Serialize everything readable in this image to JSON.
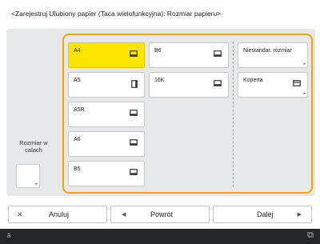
{
  "title": "<Zarejestruj Ulubiony papier (Taca wielofunkcyjna): Rozmiar papieru>",
  "left": {
    "label": "Rozmiar w calach"
  },
  "paper_keys": [
    {
      "label": "A4",
      "icon": "paper-landscape-icon",
      "selected": true
    },
    {
      "label": "A5",
      "icon": "paper-portrait-icon",
      "selected": false
    },
    {
      "label": "A5R",
      "icon": "paper-landscape-icon",
      "selected": false
    },
    {
      "label": "A6",
      "icon": "paper-landscape-icon",
      "selected": false
    },
    {
      "label": "B5",
      "icon": "paper-landscape-icon",
      "selected": false
    },
    {
      "label": "B6",
      "icon": "paper-landscape-icon",
      "selected": false
    },
    {
      "label": "16K",
      "icon": "paper-landscape-icon",
      "selected": false
    }
  ],
  "special_keys": [
    {
      "label": "Niestandar. rozmiar"
    },
    {
      "label": "Koperta",
      "icon": "envelope-icon"
    }
  ],
  "footer": {
    "cancel": "Anuluj",
    "back": "Powrót",
    "next": "Dalej"
  },
  "colors": {
    "selected": "#ffe600",
    "frame": "#f0a800",
    "status_bar": "#252628"
  }
}
